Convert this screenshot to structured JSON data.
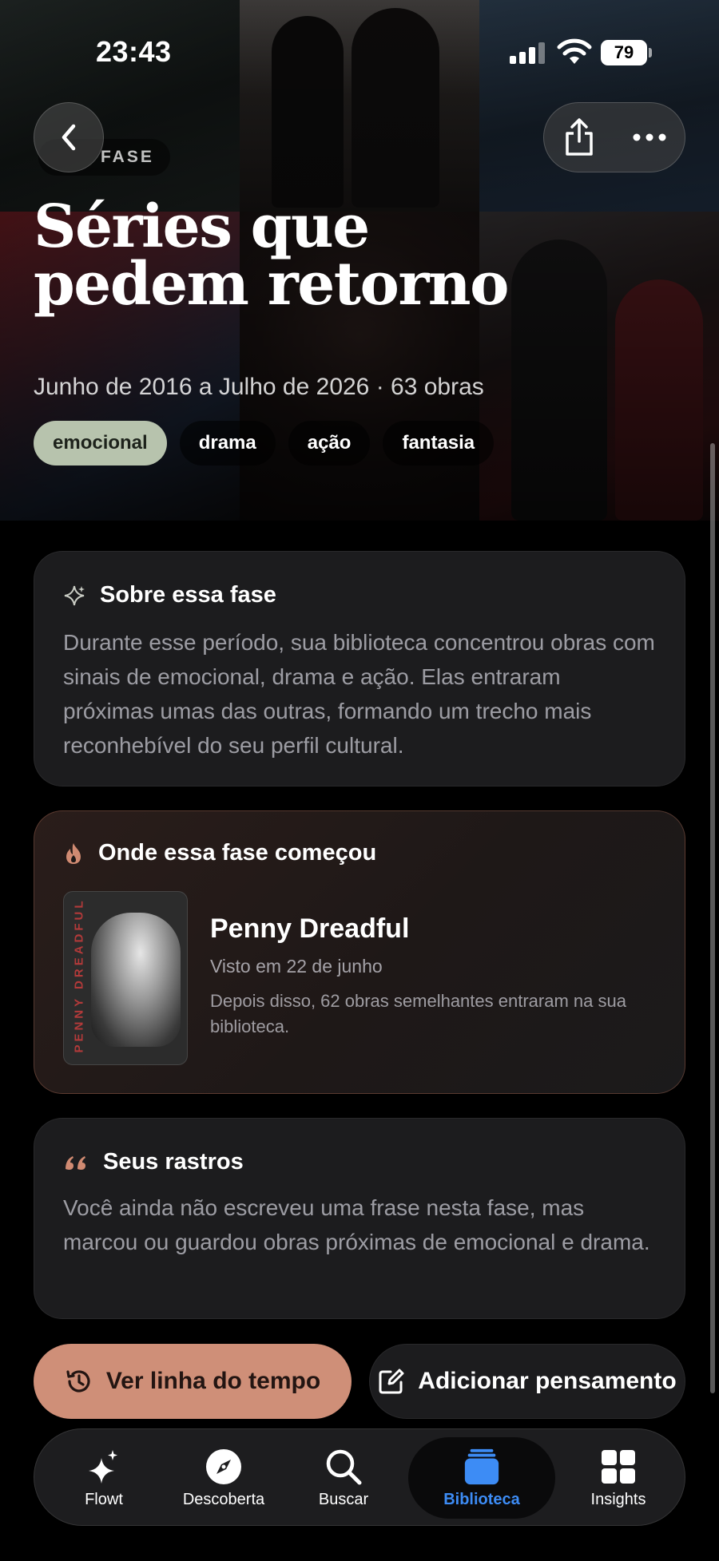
{
  "status_bar": {
    "time": "23:43",
    "battery": "79"
  },
  "header": {
    "phase_label": "FASE",
    "title_line1": "Séries que",
    "title_line2": "pedem retorno",
    "subtitle": "Junho de 2016 a Julho de 2026 · 63 obras",
    "tags": [
      "emocional",
      "drama",
      "ação",
      "fantasia"
    ],
    "active_tag": "emocional"
  },
  "about": {
    "icon": "sparkle-icon",
    "title": "Sobre essa fase",
    "text": "Durante esse período, sua biblioteca concentrou obras com sinais de emocional, drama e ação. Elas entraram próximas umas das outras, formando um trecho mais reconhebível do seu perfil cultural."
  },
  "origin": {
    "icon": "flame-icon",
    "title": "Onde essa fase começou",
    "poster_text": "PENNY DREADFUL",
    "work_title": "Penny Dreadful",
    "seen": "Visto em 22 de junho",
    "description": "Depois disso, 62 obras semelhantes entraram na sua biblioteca."
  },
  "traces": {
    "icon": "quote-icon",
    "title": "Seus rastros",
    "text": "Você ainda não escreveu uma frase nesta fase, mas marcou ou guardou obras próximas de emocional e drama."
  },
  "actions": {
    "timeline_label": "Ver linha do tempo",
    "thought_label": "Adicionar pensamento"
  },
  "tabbar": {
    "items": [
      {
        "label": "Flowt",
        "icon": "sparkles-icon"
      },
      {
        "label": "Descoberta",
        "icon": "compass-icon"
      },
      {
        "label": "Buscar",
        "icon": "search-icon"
      },
      {
        "label": "Biblioteca",
        "icon": "library-stack-icon"
      },
      {
        "label": "Insights",
        "icon": "grid-icon"
      }
    ],
    "active": "Biblioteca"
  },
  "colors": {
    "accent_timeline": "#cf8f78",
    "active_tag": "#b7c3ad",
    "active_tab": "#3d8cf5"
  }
}
